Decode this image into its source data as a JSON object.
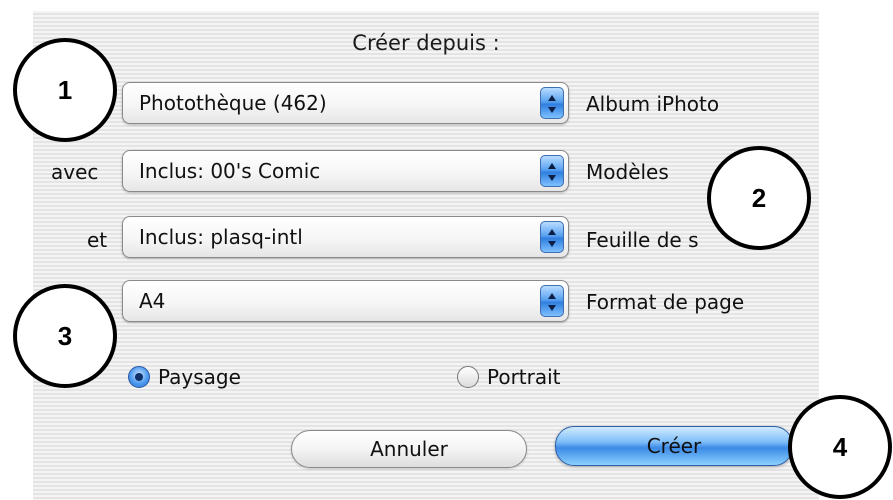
{
  "dialog": {
    "heading": "Créer depuis :",
    "rows": [
      {
        "left_label": "",
        "value": "Photothèque (462)",
        "right_label": "Album iPhoto"
      },
      {
        "left_label": "avec",
        "value": "Inclus: 00's Comic",
        "right_label": "Modèles"
      },
      {
        "left_label": "et",
        "value": "Inclus: plasq-intl",
        "right_label": "Feuille de s"
      },
      {
        "left_label": "",
        "value": "A4",
        "right_label": "Format de page"
      }
    ],
    "orientation": {
      "landscape_label": "Paysage",
      "portrait_label": "Portrait",
      "selected": "Paysage"
    },
    "buttons": {
      "cancel_label": "Annuler",
      "create_label": "Créer"
    }
  },
  "callouts": [
    "1",
    "2",
    "3",
    "4"
  ],
  "colors": {
    "accent": "#4f9bf0",
    "callout_border": "#000000"
  }
}
